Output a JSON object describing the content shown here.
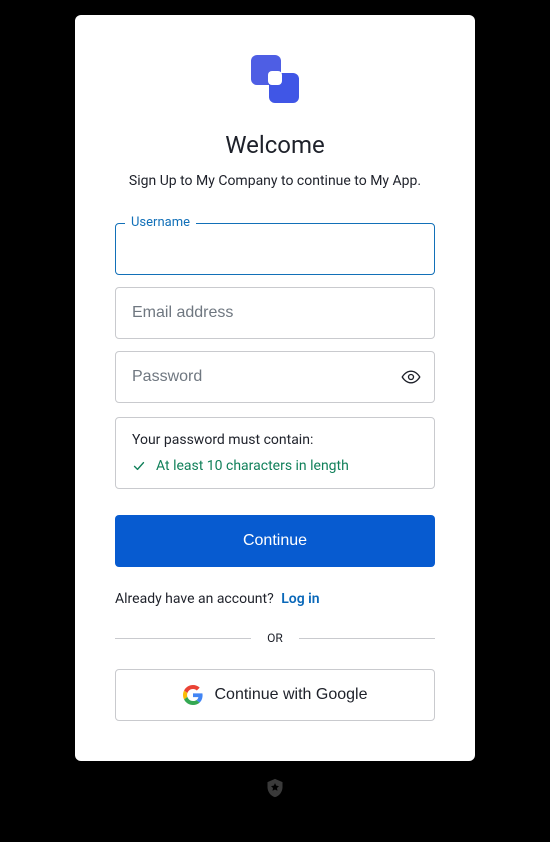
{
  "title": "Welcome",
  "subtitle": "Sign Up to My Company to continue to My App.",
  "fields": {
    "username": {
      "label": "Username",
      "value": ""
    },
    "email": {
      "placeholder": "Email address",
      "value": ""
    },
    "password": {
      "placeholder": "Password",
      "value": ""
    }
  },
  "password_rules": {
    "title": "Your password must contain:",
    "items": [
      {
        "text": "At least 10 characters in length",
        "met": true
      }
    ]
  },
  "buttons": {
    "continue": "Continue",
    "google": "Continue with Google"
  },
  "login_prompt": {
    "text": "Already have an account?",
    "link": "Log in"
  },
  "divider": "OR",
  "colors": {
    "accent": "#075bd0",
    "focus_border": "#1270b8",
    "rule_met": "#11805a"
  }
}
